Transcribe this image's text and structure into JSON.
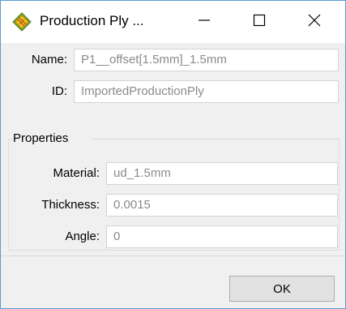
{
  "window": {
    "title": "Production Ply ..."
  },
  "fields": {
    "name": {
      "label": "Name:",
      "value": "P1__offset[1.5mm]_1.5mm"
    },
    "id": {
      "label": "ID:",
      "value": "ImportedProductionPly"
    }
  },
  "properties": {
    "title": "Properties",
    "material": {
      "label": "Material:",
      "value": "ud_1.5mm"
    },
    "thickness": {
      "label": "Thickness:",
      "value": "0.0015"
    },
    "angle": {
      "label": "Angle:",
      "value": "0"
    }
  },
  "buttons": {
    "ok": "OK"
  },
  "icons": {
    "app": "production-ply-icon",
    "minimize": "minimize-icon",
    "maximize": "maximize-icon",
    "close": "close-icon"
  },
  "colors": {
    "window_border": "#5b9bd5",
    "client_bg": "#f0f0f0",
    "field_text": "#8a8a8a"
  }
}
